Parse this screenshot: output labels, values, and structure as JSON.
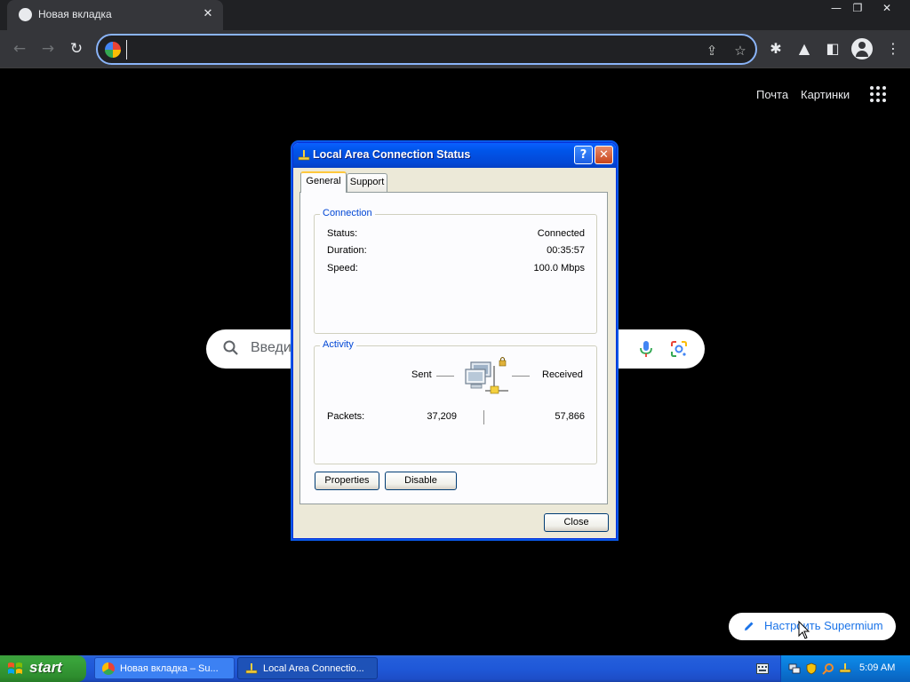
{
  "browser": {
    "tab_title": "Новая вкладка",
    "address_value": "",
    "window_controls": {
      "minimize": "—",
      "restore": "❐",
      "close": "✕"
    }
  },
  "newtab": {
    "links": {
      "mail": "Почта",
      "images": "Картинки"
    },
    "search_placeholder": "Введи",
    "customize_label": "Настроить Supermium"
  },
  "dialog": {
    "title": "Local Area Connection Status",
    "tabs": [
      "General",
      "Support"
    ],
    "connection": {
      "group_label": "Connection",
      "rows": [
        {
          "label": "Status:",
          "value": "Connected"
        },
        {
          "label": "Duration:",
          "value": "00:35:57"
        },
        {
          "label": "Speed:",
          "value": "100.0 Mbps"
        }
      ]
    },
    "activity": {
      "group_label": "Activity",
      "sent_label": "Sent",
      "received_label": "Received",
      "packets_label": "Packets:",
      "packets_sent": "37,209",
      "packets_received": "57,866"
    },
    "buttons": {
      "properties": "Properties",
      "disable": "Disable",
      "close": "Close"
    }
  },
  "taskbar": {
    "start_label": "start",
    "tasks": [
      {
        "label": "Новая вкладка – Su..."
      },
      {
        "label": "Local Area Connectio..."
      }
    ],
    "clock": "5:09 AM"
  },
  "colors": {
    "xp_blue": "#0a58e8",
    "chrome_dark": "#35363a",
    "link_blue": "#1a73e8",
    "group_label_blue": "#0046d5"
  }
}
